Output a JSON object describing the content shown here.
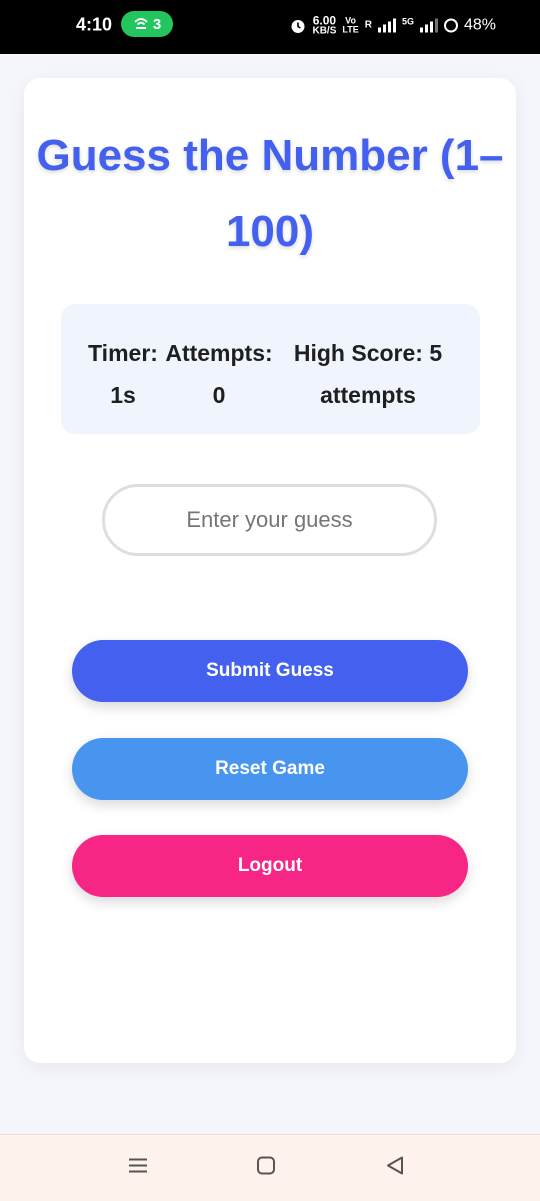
{
  "status_bar": {
    "time": "4:10",
    "hotspot_count": "3",
    "network_speed_value": "6.00",
    "network_speed_unit": "KB/S",
    "volte_top": "Vo",
    "volte_bottom": "LTE",
    "sim1_label": "R",
    "sim2_label": "5G",
    "battery": "48%"
  },
  "game": {
    "title": "Guess the Number (1–100)",
    "stats": {
      "timer_label": "Timer:",
      "timer_value": "1s",
      "attempts_label": "Attempts:",
      "attempts_value": "0",
      "high_score_label": "High Score: 5",
      "high_score_value": "attempts"
    },
    "input": {
      "placeholder": "Enter your guess",
      "value": ""
    },
    "buttons": {
      "submit": "Submit Guess",
      "reset": "Reset Game",
      "logout": "Logout"
    }
  },
  "colors": {
    "primary": "#4361ee",
    "reset": "#4895ef",
    "logout": "#f72585",
    "stats_bg": "#f0f4fc"
  },
  "navigation": {
    "icons": [
      "menu-icon",
      "home-icon",
      "back-icon"
    ]
  }
}
